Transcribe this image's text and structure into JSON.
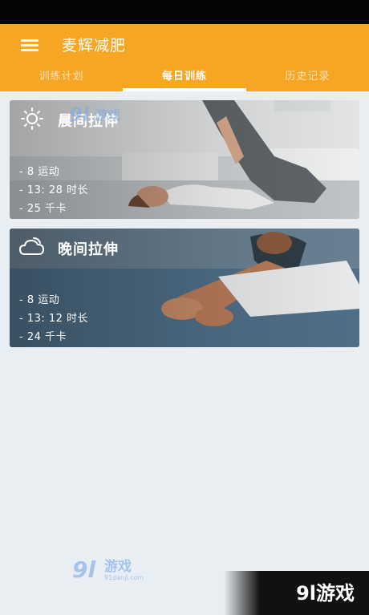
{
  "app": {
    "title": "麦辉减肥"
  },
  "tabs": [
    {
      "label": "训练计划"
    },
    {
      "label": "每日训练"
    },
    {
      "label": "历史记录"
    }
  ],
  "cards": [
    {
      "title": "晨间拉伸",
      "icon": "sun-icon",
      "stats": [
        "- 8 运动",
        "- 13: 28 时长",
        "- 25 千卡"
      ]
    },
    {
      "title": "晚间拉伸",
      "icon": "cloud-moon-icon",
      "stats": [
        "- 8 运动",
        "- 13: 12 时长",
        "- 24 千卡"
      ]
    }
  ],
  "watermark": {
    "corner_text": "9l游戏",
    "mid_text": "91游戏",
    "mid_sub": "91danji.com"
  },
  "colors": {
    "accent": "#f6a623",
    "background": "#e9eef2"
  }
}
